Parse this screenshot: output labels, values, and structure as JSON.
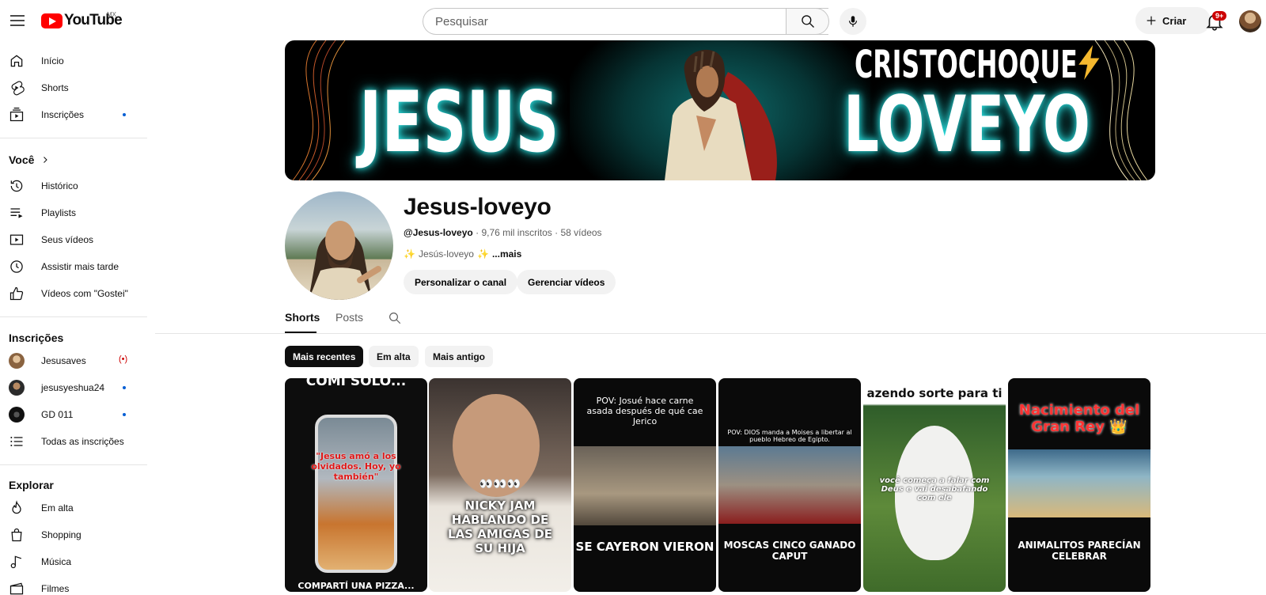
{
  "header": {
    "logo_text": "YouTube",
    "country": "MX",
    "search_placeholder": "Pesquisar",
    "create_label": "Criar",
    "notifications_badge": "9+"
  },
  "sidebar": {
    "main": [
      {
        "label": "Início",
        "icon": "home-icon"
      },
      {
        "label": "Shorts",
        "icon": "shorts-icon"
      },
      {
        "label": "Inscrições",
        "icon": "subscriptions-icon"
      }
    ],
    "you_heading": "Você",
    "you": [
      {
        "label": "Histórico",
        "icon": "history-icon"
      },
      {
        "label": "Playlists",
        "icon": "playlists-icon"
      },
      {
        "label": "Seus vídeos",
        "icon": "your-videos-icon"
      },
      {
        "label": "Assistir mais tarde",
        "icon": "watch-later-icon"
      },
      {
        "label": "Vídeos com \"Gostei\"",
        "icon": "liked-icon"
      }
    ],
    "subs_heading": "Inscrições",
    "subs": [
      {
        "label": "Jesusaves",
        "status": "live"
      },
      {
        "label": "jesusyeshua24",
        "status": "new"
      },
      {
        "label": "GD 011",
        "status": "new"
      },
      {
        "label": "Todas as inscrições",
        "status": "none"
      }
    ],
    "explore_heading": "Explorar",
    "explore": [
      {
        "label": "Em alta",
        "icon": "trending-icon"
      },
      {
        "label": "Shopping",
        "icon": "shopping-icon"
      },
      {
        "label": "Música",
        "icon": "music-icon"
      },
      {
        "label": "Filmes",
        "icon": "movies-icon"
      }
    ]
  },
  "banner": {
    "left_word": "JESUS",
    "right_word": "LOVEYO",
    "top_word": "CRISTOCHOQUE"
  },
  "channel": {
    "name": "Jesus-loveyo",
    "handle": "@Jesus-loveyo",
    "subscribers": "9,76 mil inscritos",
    "videos": "58 vídeos",
    "description": "Jesús-loveyo",
    "more": "...mais",
    "customize_label": "Personalizar o canal",
    "manage_label": "Gerenciar vídeos"
  },
  "tabs": [
    {
      "label": "Shorts",
      "active": true
    },
    {
      "label": "Posts",
      "active": false
    }
  ],
  "filters": [
    {
      "label": "Mais recentes",
      "active": true
    },
    {
      "label": "Em alta",
      "active": false
    },
    {
      "label": "Mais antigo",
      "active": false
    }
  ],
  "shorts": [
    {
      "top_text": "COMÍ SOLO...",
      "overlay": "\"Jesus amó a los olvidados. Hoy, yo también\"",
      "bottom_text": "COMPARTÍ UNA PIZZA..."
    },
    {
      "top_text": "",
      "overlay": "👀👀👀",
      "bottom_text": "NICKY JAM HABLANDO DE LAS AMIGAS DE SU HIJA"
    },
    {
      "top_text": "POV: Josué hace carne asada después de qué cae Jerico",
      "overlay": "",
      "bottom_text": "SE CAYERON VIERON"
    },
    {
      "top_text": "POV: DIOS manda a Moises a libertar al pueblo Hebreo de Egipto.",
      "overlay": "",
      "bottom_text": "MOSCAS CINCO GANADO CAPUT"
    },
    {
      "top_text": "azendo sorte para ti",
      "overlay": "você começa a falar com Deus e vai desabafando com ele",
      "bottom_text": ""
    },
    {
      "top_text": "Nacimiento del Gran Rey 👑",
      "overlay": "",
      "bottom_text": "ANIMALITOS PARECÍAN CELEBRAR"
    }
  ]
}
